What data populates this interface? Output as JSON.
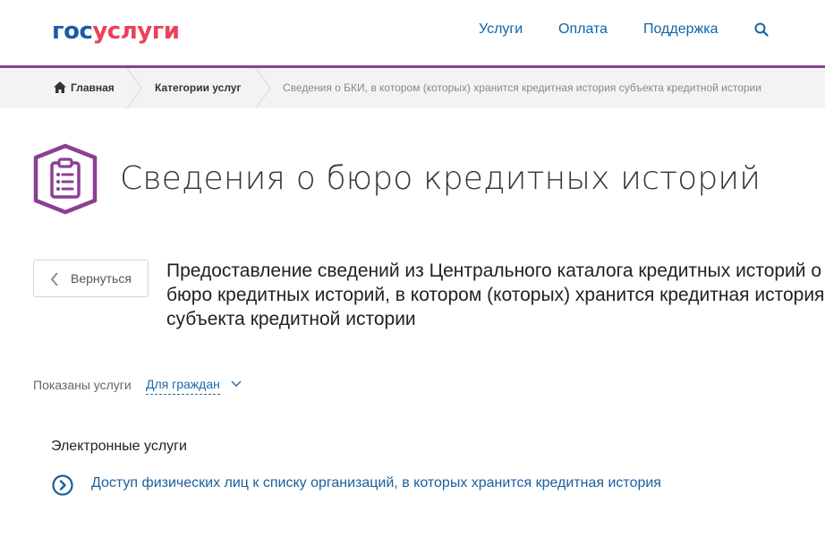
{
  "header": {
    "logo_part1": "гос",
    "logo_part2": "услуги",
    "nav": [
      "Услуги",
      "Оплата",
      "Поддержка"
    ]
  },
  "breadcrumb": {
    "home": "Главная",
    "categories": "Категории услуг",
    "current": "Сведения о БКИ, в котором (которых) хранится кредитная история субъекта кредитной истории"
  },
  "page": {
    "title": "Сведения о бюро кредитных историй",
    "back_label": "Вернуться",
    "service_heading": "Предоставление сведений из Центрального каталога кредитных историй о бюро кредитных историй, в котором (которых) хранится кредитная история субъекта кредитной истории"
  },
  "filter": {
    "label": "Показаны услуги",
    "selected": "Для граждан"
  },
  "services": {
    "section_title": "Электронные услуги",
    "items": [
      "Доступ физических лиц к списку организаций, в которых хранится кредитная история"
    ]
  },
  "icons": {
    "home": "home-icon",
    "search": "search-icon",
    "title": "clipboard-list-icon",
    "back": "chevron-left-icon",
    "filter": "chevron-down-icon",
    "service": "circle-arrow-right-icon"
  },
  "colors": {
    "brand_blue": "#1a5aa8",
    "brand_red": "#ee3f58",
    "accent_purple": "#8b3f93",
    "link_blue": "#1a5f9e"
  }
}
